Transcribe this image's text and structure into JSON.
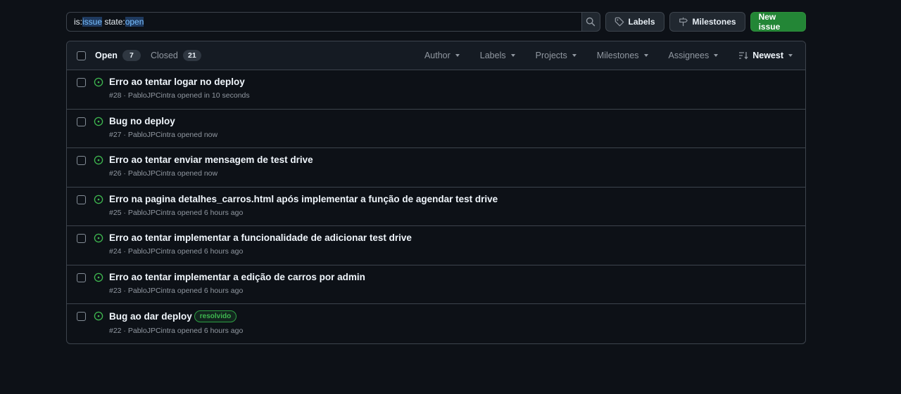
{
  "search": {
    "parts": [
      {
        "text": "is:",
        "hl": false
      },
      {
        "text": "issue",
        "hl": true
      },
      {
        "text": " state:",
        "hl": false
      },
      {
        "text": "open",
        "hl": true
      }
    ]
  },
  "toolbar": {
    "labels_label": "Labels",
    "milestones_label": "Milestones",
    "new_issue_label": "New issue"
  },
  "tabs": {
    "open_label": "Open",
    "open_count": "7",
    "closed_label": "Closed",
    "closed_count": "21"
  },
  "filters": [
    "Author",
    "Labels",
    "Projects",
    "Milestones",
    "Assignees"
  ],
  "sort_label": "Newest",
  "colors": {
    "open_icon": "#3fb950",
    "accent_green": "#238636"
  },
  "issues": [
    {
      "title": "Erro ao tentar logar no deploy",
      "meta": "#28 · PabloJPCintra opened in 10 seconds",
      "label": ""
    },
    {
      "title": "Bug no deploy",
      "meta": "#27 · PabloJPCintra opened now",
      "label": ""
    },
    {
      "title": "Erro ao tentar enviar mensagem de test drive",
      "meta": "#26 · PabloJPCintra opened now",
      "label": ""
    },
    {
      "title": "Erro na pagina detalhes_carros.html após implementar a função de agendar test drive",
      "meta": "#25 · PabloJPCintra opened 6 hours ago",
      "label": ""
    },
    {
      "title": "Erro ao tentar implementar a funcionalidade de adicionar test drive",
      "meta": "#24 · PabloJPCintra opened 6 hours ago",
      "label": ""
    },
    {
      "title": "Erro ao tentar implementar a edição de carros por admin",
      "meta": "#23 · PabloJPCintra opened 6 hours ago",
      "label": ""
    },
    {
      "title": "Bug ao dar deploy",
      "meta": "#22 · PabloJPCintra opened 6 hours ago",
      "label": "resolvido"
    }
  ]
}
